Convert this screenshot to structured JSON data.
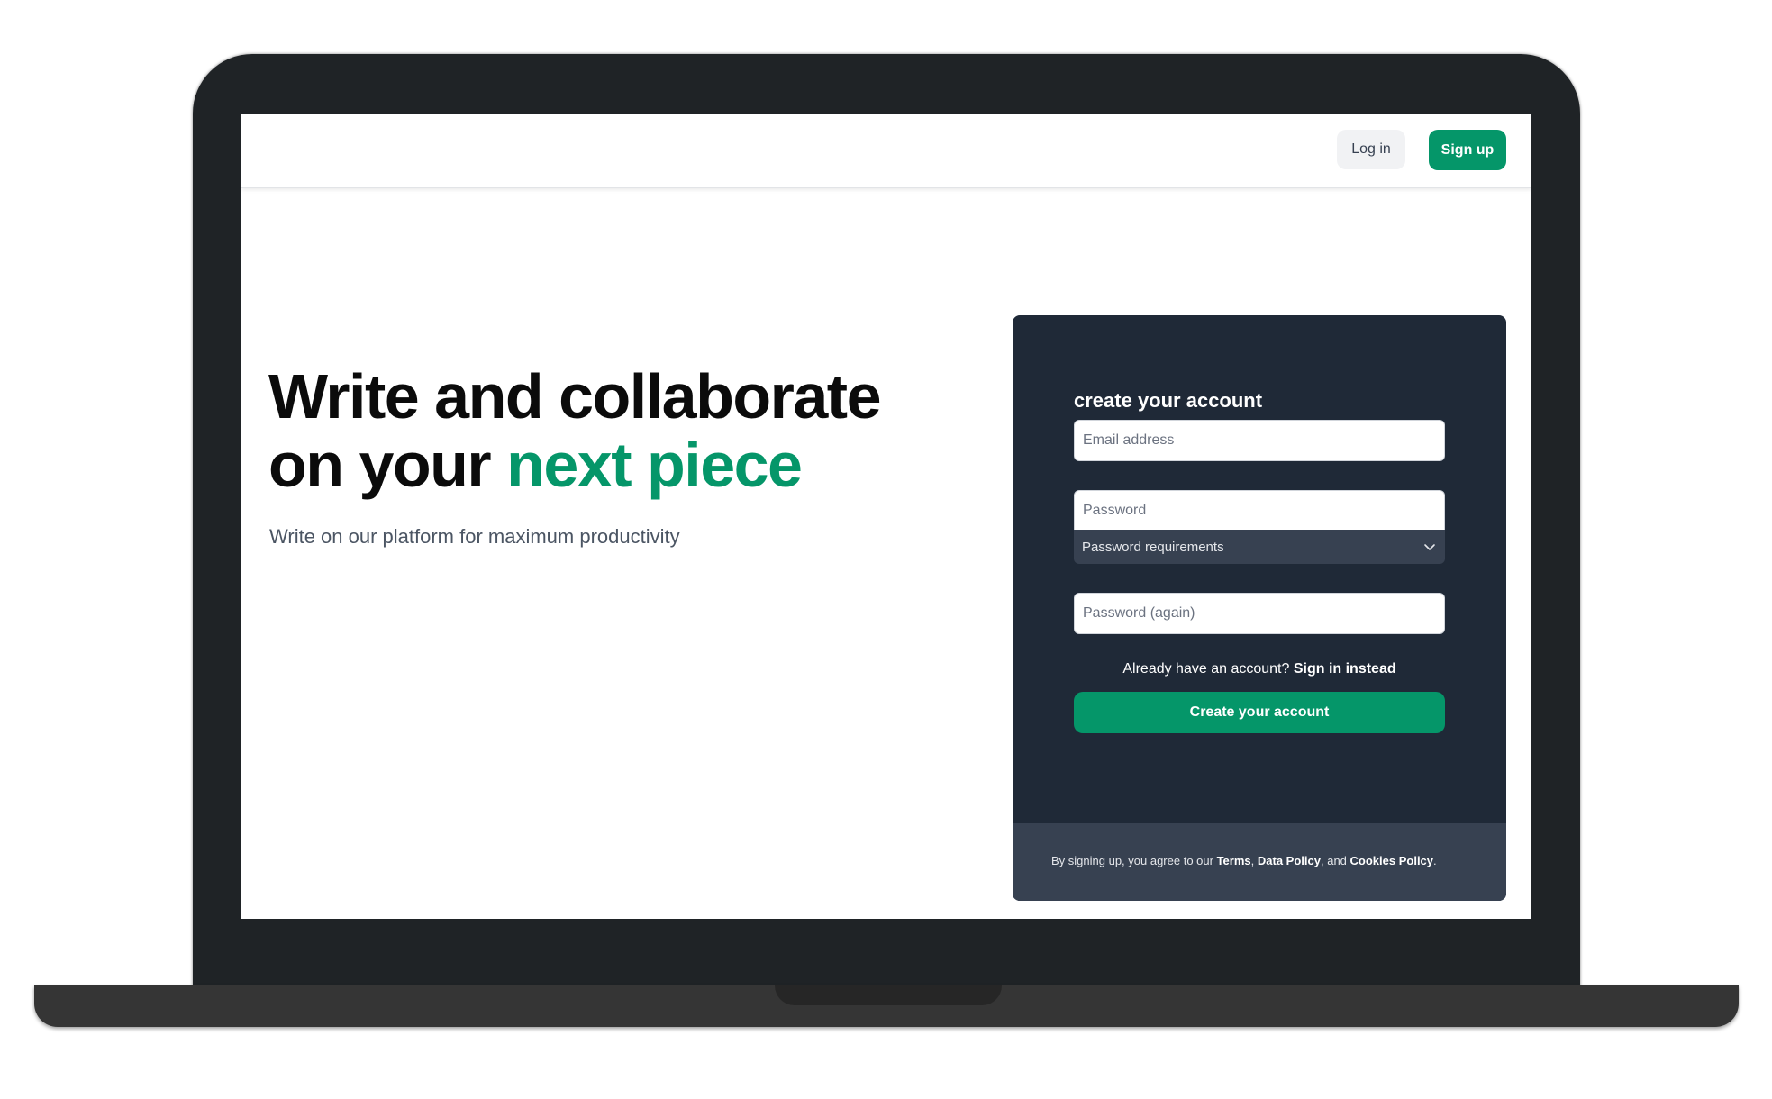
{
  "header": {
    "login_label": "Log in",
    "signup_label": "Sign up"
  },
  "hero": {
    "title_line1": "Write and collaborate",
    "title_line2_prefix": "on your ",
    "title_line2_accent": "next piece",
    "subtitle": "Write on our platform for maximum productivity"
  },
  "signup_form": {
    "title": "create your account",
    "email_placeholder": "Email address",
    "email_value": "",
    "password_placeholder": "Password",
    "password_value": "",
    "password_requirements_label": "Password requirements",
    "password_again_placeholder": "Password (again)",
    "password_again_value": "",
    "already_text": "Already have an account?",
    "sign_in_link": "Sign in instead",
    "submit_label": "Create your account"
  },
  "footer": {
    "terms_prefix": "By signing up, you agree to our",
    "terms_link": "Terms",
    "separator": ",",
    "data_policy_link": "Data Policy",
    "and_text": ", and",
    "cookies_link": "Cookies Policy",
    "period": "."
  },
  "icons": {
    "password_requirements_toggle": "chevron-down-icon"
  },
  "colors": {
    "accent": "#059669",
    "card_background": "#1f2937",
    "card_footer_background": "#374151",
    "heading_text": "#0b0b0b",
    "subtitle_text": "#4b5563"
  }
}
